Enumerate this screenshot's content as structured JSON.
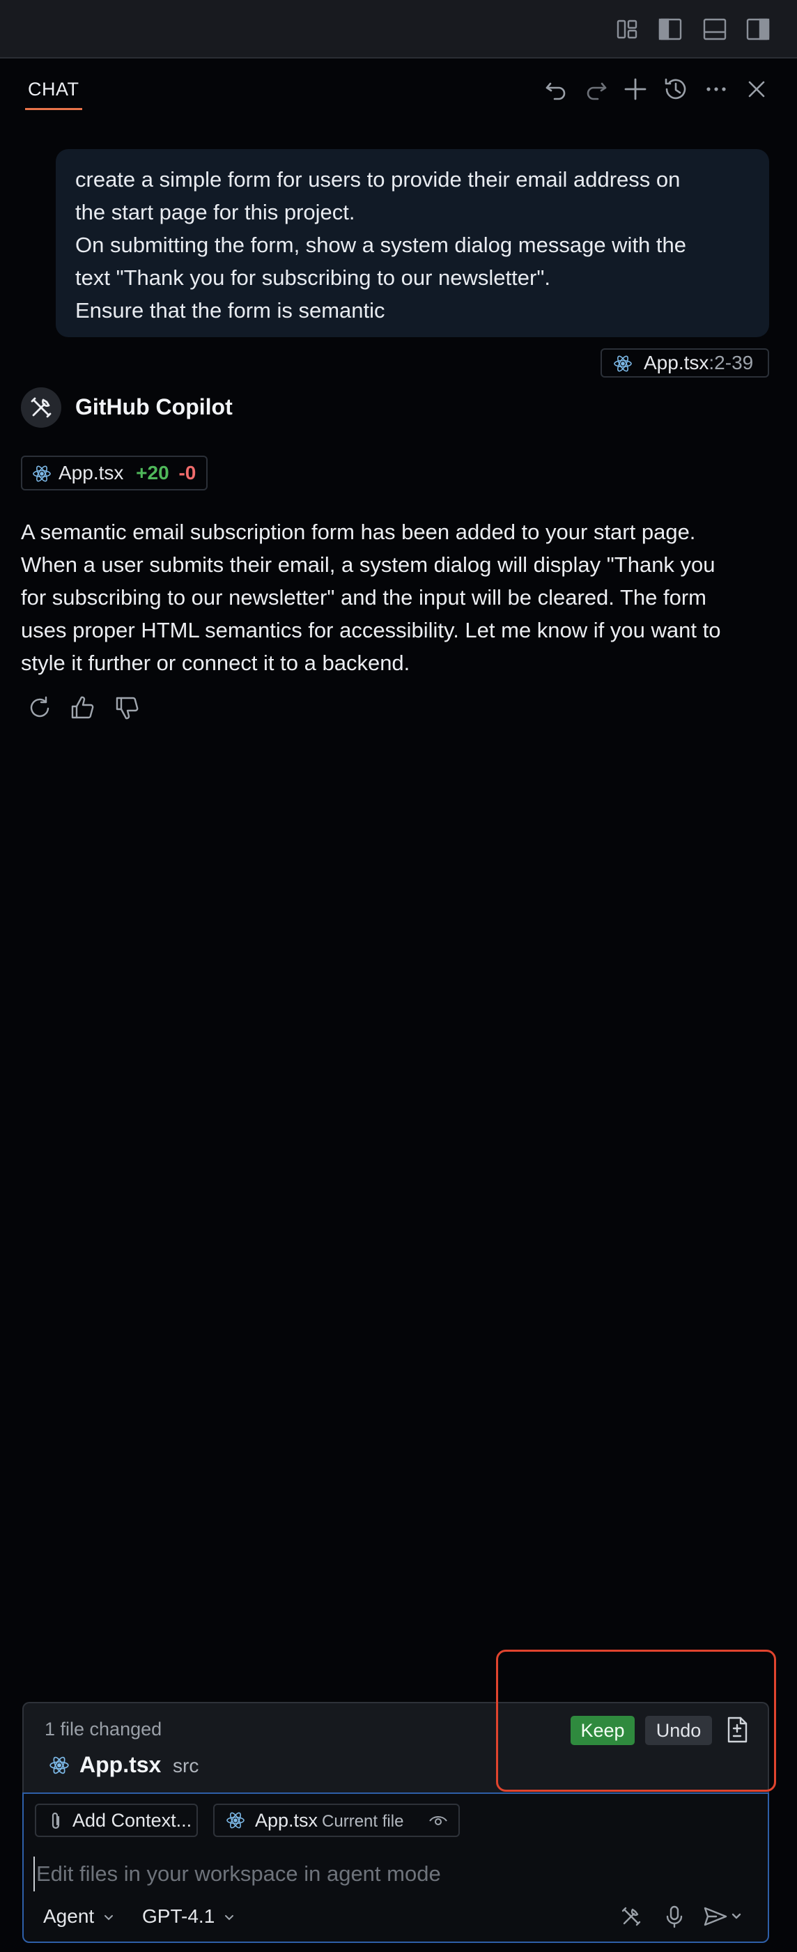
{
  "topbar": {
    "icons": [
      "customize-layout-icon",
      "toggle-primary-sidebar-icon",
      "toggle-panel-icon",
      "toggle-secondary-sidebar-icon"
    ]
  },
  "chat_header": {
    "tab_label": "CHAT",
    "icons": [
      "undo-icon",
      "redo-icon",
      "new-chat-icon",
      "history-icon",
      "more-icon",
      "close-icon"
    ]
  },
  "user_message": {
    "lines": [
      "create a simple form for users to provide their email address on",
      "the start page for this project.",
      "On submitting the form, show a system dialog message with the",
      "text \"Thank you for subscribing to our newsletter\".",
      "Ensure that the form is semantic"
    ],
    "reference": {
      "file": "App.tsx",
      "range": ":2-39"
    }
  },
  "response": {
    "author": "GitHub Copilot",
    "edited_file": {
      "name": "App.tsx",
      "added": "+20",
      "removed": "-0"
    },
    "lines": [
      "A semantic email subscription form has been added to your start page.",
      "When a user submits their email, a system dialog will display \"Thank you",
      "for subscribing to our newsletter\" and the input will be cleared. The form",
      "uses proper HTML semantics for accessibility. Let me know if you want to",
      "style it further or connect it to a backend."
    ],
    "feedback_icons": [
      "retry-icon",
      "thumbs-up-icon",
      "thumbs-down-icon"
    ]
  },
  "changes": {
    "count_label": "1 file changed",
    "keep_label": "Keep",
    "undo_label": "Undo",
    "file_name": "App.tsx",
    "file_dir": "src"
  },
  "input": {
    "add_context_label": "Add Context...",
    "current_file_name": "App.tsx",
    "current_file_sub": "Current file",
    "placeholder": "Edit files in your workspace in agent mode",
    "value": "",
    "mode": "Agent",
    "model": "GPT-4.1"
  },
  "colors": {
    "accent_tab": "#e8734a",
    "keep_bg": "#2f8a3e",
    "added": "#4fb85a",
    "removed": "#f06c6c",
    "highlight": "#e0442e",
    "input_border": "#2e5fa8"
  }
}
